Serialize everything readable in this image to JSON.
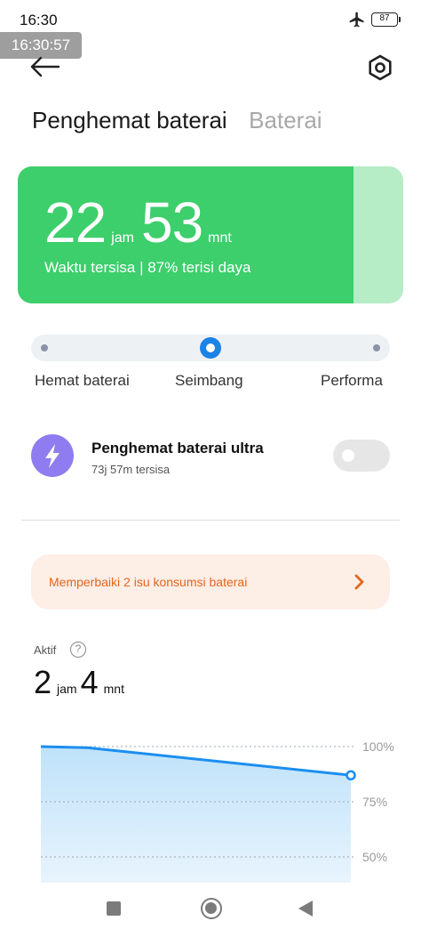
{
  "status_bar": {
    "time": "16:30",
    "battery_level": "87",
    "overlay_time": "16:30:57",
    "icons": [
      "airplane-mode-icon",
      "battery-icon"
    ]
  },
  "header": {
    "back_icon": "arrow-left-icon",
    "settings_icon": "gear-icon"
  },
  "tabs": [
    {
      "label": "Penghemat baterai",
      "active": true
    },
    {
      "label": "Baterai",
      "active": false
    }
  ],
  "battery_card": {
    "hours": "22",
    "hours_unit": "jam",
    "minutes": "53",
    "minutes_unit": "mnt",
    "subtitle": "Waktu tersisa | 87% terisi daya",
    "charge_fraction": 0.87,
    "fill_color": "#3ccf6b",
    "rest_color": "#b6ecc6"
  },
  "mode_selector": {
    "options": [
      "Hemat baterai",
      "Seimbang",
      "Performa"
    ],
    "selected_index": 1,
    "accent_color": "#1b82e6"
  },
  "ultra_saver": {
    "title": "Penghemat baterai ultra",
    "subtitle": "73j 57m tersisa",
    "enabled": false,
    "icon": "lightning-bolt-icon",
    "icon_color": "#8e7cf0"
  },
  "issue_banner": {
    "text": "Memperbaiki 2 isu konsumsi baterai",
    "color": "#e4661c",
    "icon": "chevron-right-icon"
  },
  "active_usage": {
    "label": "Aktif",
    "hours": "2",
    "hours_unit": "jam",
    "minutes": "4",
    "minutes_unit": "mnt",
    "help_icon": "question-mark-icon"
  },
  "chart_data": {
    "type": "area",
    "x": [
      0,
      0.15,
      1
    ],
    "values": [
      100,
      99.5,
      87
    ],
    "ylim": [
      50,
      100
    ],
    "y_ticks": [
      "100%",
      "75%",
      "50%"
    ],
    "y_tick_values": [
      100,
      75,
      50
    ],
    "grid": true,
    "line_color": "#1b8ff0",
    "fill_color": "#cfe9fb"
  },
  "nav_bar": {
    "icons": [
      "recent-apps-icon",
      "home-icon",
      "back-triangle-icon"
    ]
  }
}
